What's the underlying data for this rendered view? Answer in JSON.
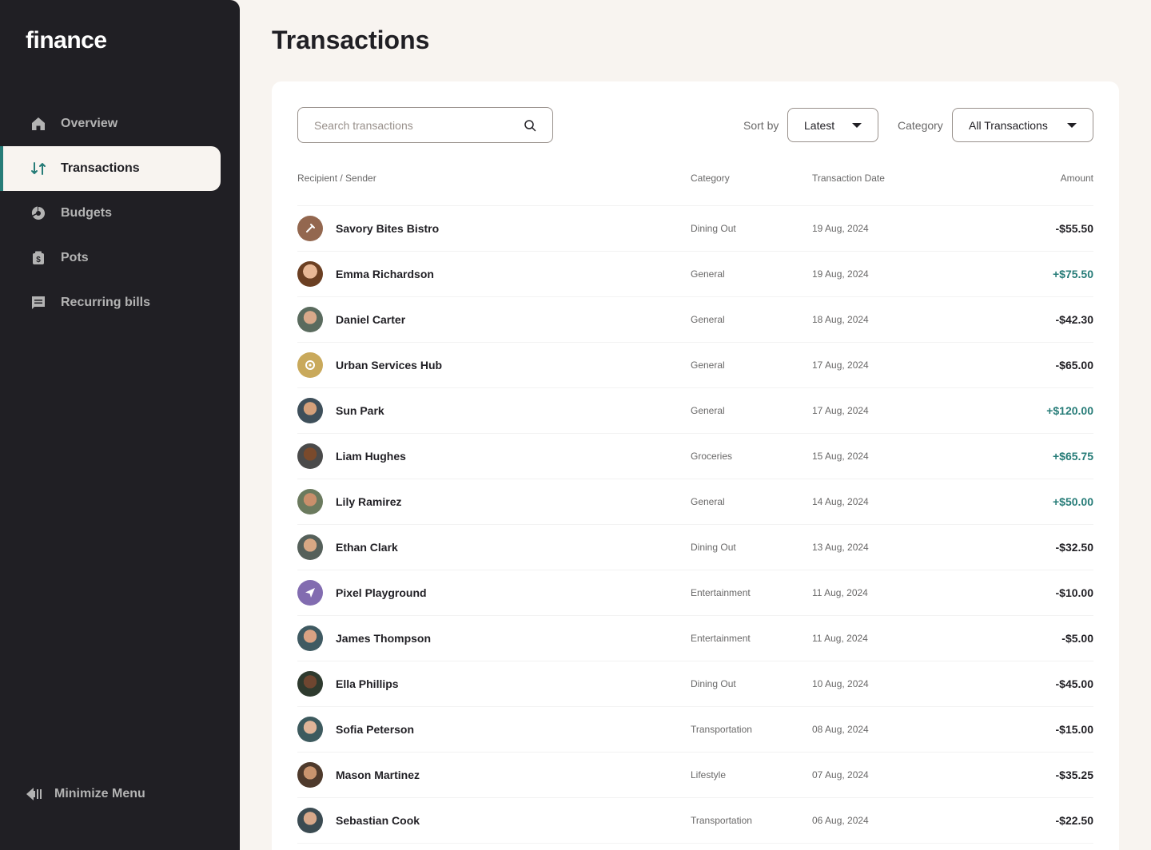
{
  "app": {
    "logo": "finance"
  },
  "nav": {
    "items": [
      {
        "label": "Overview",
        "icon": "home-icon"
      },
      {
        "label": "Transactions",
        "icon": "transactions-icon",
        "active": true
      },
      {
        "label": "Budgets",
        "icon": "budget-pie-icon"
      },
      {
        "label": "Pots",
        "icon": "pots-icon"
      },
      {
        "label": "Recurring bills",
        "icon": "bills-icon"
      }
    ],
    "minimize_label": "Minimize Menu"
  },
  "page": {
    "title": "Transactions"
  },
  "controls": {
    "search_placeholder": "Search transactions",
    "sort_label": "Sort by",
    "sort_value": "Latest",
    "category_label": "Category",
    "category_value": "All Transactions"
  },
  "table": {
    "headers": {
      "recipient": "Recipient / Sender",
      "category": "Category",
      "date": "Transaction Date",
      "amount": "Amount"
    },
    "rows": [
      {
        "name": "Savory Bites Bistro",
        "category": "Dining Out",
        "date": "19 Aug, 2024",
        "amount": "-$55.50"
      },
      {
        "name": "Emma Richardson",
        "category": "General",
        "date": "19 Aug, 2024",
        "amount": "+$75.50"
      },
      {
        "name": "Daniel Carter",
        "category": "General",
        "date": "18 Aug, 2024",
        "amount": "-$42.30"
      },
      {
        "name": "Urban Services Hub",
        "category": "General",
        "date": "17 Aug, 2024",
        "amount": "-$65.00"
      },
      {
        "name": "Sun Park",
        "category": "General",
        "date": "17 Aug, 2024",
        "amount": "+$120.00"
      },
      {
        "name": "Liam Hughes",
        "category": "Groceries",
        "date": "15 Aug, 2024",
        "amount": "+$65.75"
      },
      {
        "name": "Lily Ramirez",
        "category": "General",
        "date": "14 Aug, 2024",
        "amount": "+$50.00"
      },
      {
        "name": "Ethan Clark",
        "category": "Dining Out",
        "date": "13 Aug, 2024",
        "amount": "-$32.50"
      },
      {
        "name": "Pixel Playground",
        "category": "Entertainment",
        "date": "11 Aug, 2024",
        "amount": "-$10.00"
      },
      {
        "name": "James Thompson",
        "category": "Entertainment",
        "date": "11 Aug, 2024",
        "amount": "-$5.00"
      },
      {
        "name": "Ella Phillips",
        "category": "Dining Out",
        "date": "10 Aug, 2024",
        "amount": "-$45.00"
      },
      {
        "name": "Sofia Peterson",
        "category": "Transportation",
        "date": "08 Aug, 2024",
        "amount": "-$15.00"
      },
      {
        "name": "Mason Martinez",
        "category": "Lifestyle",
        "date": "07 Aug, 2024",
        "amount": "-$35.25"
      },
      {
        "name": "Sebastian Cook",
        "category": "Transportation",
        "date": "06 Aug, 2024",
        "amount": "-$22.50"
      }
    ]
  },
  "colors": {
    "sidebar": "#201f24",
    "background": "#f8f4f0",
    "accent": "#277c78",
    "positive_amount": "#277c78",
    "muted_text": "#696868"
  }
}
